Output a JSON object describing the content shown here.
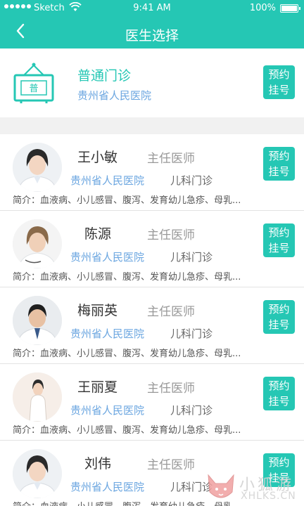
{
  "status_bar": {
    "carrier": "Sketch",
    "time": "9:41 AM",
    "battery": "100%"
  },
  "nav": {
    "title": "医生选择",
    "back_icon": "chevron-left-icon"
  },
  "clinic": {
    "icon_label": "普",
    "name": "普通门诊",
    "hospital": "贵州省人民医院",
    "button": [
      "预约",
      "挂号"
    ]
  },
  "doctors": [
    {
      "name": "王小敏",
      "title": "主任医师",
      "hospital": "贵州省人民医院",
      "dept": "儿科门诊",
      "intro": "简介：血液病、小儿感冒、腹泻、发育幼儿急疹、母乳...",
      "button": [
        "预约",
        "挂号"
      ]
    },
    {
      "name": "陈源",
      "title": "主任医师",
      "hospital": "贵州省人民医院",
      "dept": "儿科门诊",
      "intro": "简介：血液病、小儿感冒、腹泻、发育幼儿急疹、母乳...",
      "button": [
        "预约",
        "挂号"
      ]
    },
    {
      "name": "梅丽英",
      "title": "主任医师",
      "hospital": "贵州省人民医院",
      "dept": "儿科门诊",
      "intro": "简介：血液病、小儿感冒、腹泻、发育幼儿急疹、母乳...",
      "button": [
        "预约",
        "挂号"
      ]
    },
    {
      "name": "王丽夏",
      "title": "主任医师",
      "hospital": "贵州省人民医院",
      "dept": "儿科门诊",
      "intro": "简介：血液病、小儿感冒、腹泻、发育幼儿急疹、母乳...",
      "button": [
        "预约",
        "挂号"
      ]
    },
    {
      "name": "刘伟",
      "title": "主任医师",
      "hospital": "贵州省人民医院",
      "dept": "儿科门诊",
      "intro": "简介：血液病、小儿感冒、腹泻、发育幼儿急疹、母乳...",
      "button": [
        "预约",
        "挂号"
      ]
    }
  ],
  "watermark": {
    "cn": "小狐游",
    "en": "XHLKS.CN"
  },
  "colors": {
    "accent": "#25c7b4",
    "link_blue": "#6ba6e0"
  }
}
